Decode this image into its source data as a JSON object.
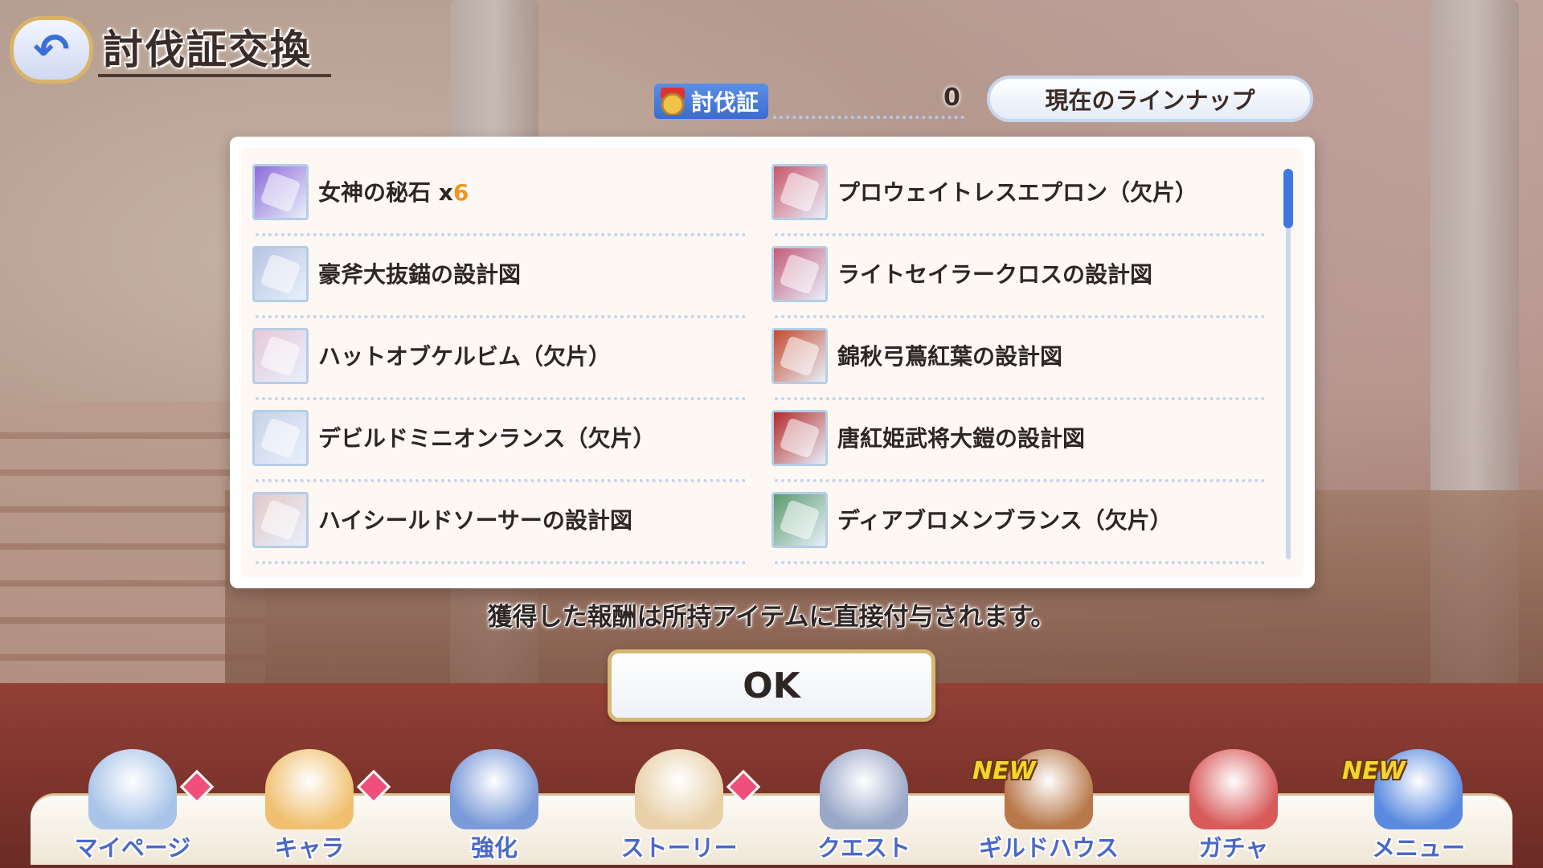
{
  "header": {
    "back_label": "↶",
    "title": "討伐証交換"
  },
  "currency": {
    "name": "討伐証",
    "count": "0",
    "lineup_button": "現在のラインナップ"
  },
  "items": [
    {
      "name": "女神の秘石 x",
      "qty": "6",
      "color": "#8e6ad8"
    },
    {
      "name": "プロウェイトレスエプロン（欠片）",
      "qty": "",
      "color": "#c9566a"
    },
    {
      "name": "豪斧大抜錨の設計図",
      "qty": "",
      "color": "#b8c4e2"
    },
    {
      "name": "ライトセイラークロスの設計図",
      "qty": "",
      "color": "#c45b78"
    },
    {
      "name": "ハットオブケルビム（欠片）",
      "qty": "",
      "color": "#e8c8d8"
    },
    {
      "name": "錦秋弓蔦紅葉の設計図",
      "qty": "",
      "color": "#c44a2e"
    },
    {
      "name": "デビルドミニオンランス（欠片）",
      "qty": "",
      "color": "#c8d2e8"
    },
    {
      "name": "唐紅姫武将大鎧の設計図",
      "qty": "",
      "color": "#b42a2a"
    },
    {
      "name": "ハイシールドソーサーの設計図",
      "qty": "",
      "color": "#e4c8c8"
    },
    {
      "name": "ディアブロメンブランス（欠片）",
      "qty": "",
      "color": "#5a9a6a"
    }
  ],
  "notice": "獲得した報酬は所持アイテムに直接付与されます。",
  "ok_label": "OK",
  "nav": [
    {
      "label": "マイページ",
      "badge": "diamond",
      "new": "",
      "color": "#a8c4e8"
    },
    {
      "label": "キャラ",
      "badge": "diamond",
      "new": "",
      "color": "#f0c070"
    },
    {
      "label": "強化",
      "badge": "",
      "new": "",
      "color": "#7a9ad8"
    },
    {
      "label": "ストーリー",
      "badge": "diamond",
      "new": "",
      "color": "#e8d0a8"
    },
    {
      "label": "クエスト",
      "badge": "",
      "new": "",
      "color": "#9aa8c8"
    },
    {
      "label": "ギルドハウス",
      "badge": "",
      "new": "NEW",
      "color": "#b8784a"
    },
    {
      "label": "ガチャ",
      "badge": "",
      "new": "",
      "color": "#d85a5a"
    },
    {
      "label": "メニュー",
      "badge": "",
      "new": "NEW",
      "color": "#5a8ae0"
    }
  ]
}
